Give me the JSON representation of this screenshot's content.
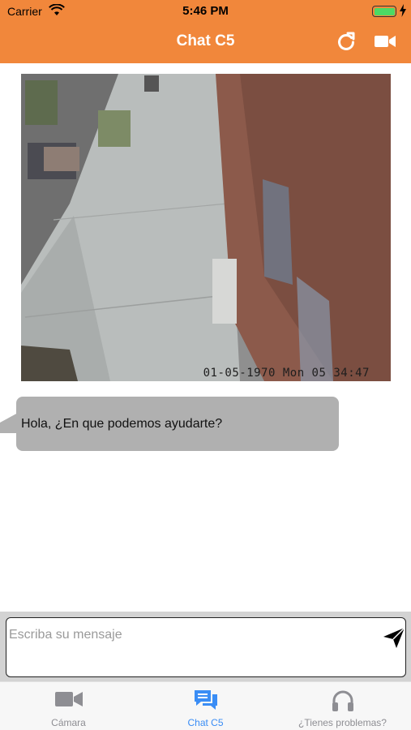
{
  "status_bar": {
    "carrier": "Carrier",
    "time": "5:46 PM",
    "battery_color": "#4CD964"
  },
  "nav": {
    "title": "Chat C5",
    "background": "#F1873B",
    "right_icons": [
      "refresh-icon",
      "video-camera-icon"
    ]
  },
  "camera_feed": {
    "timestamp": "01-05-1970 Mon 05 34:47"
  },
  "messages": [
    {
      "from": "agent",
      "text": "Hola, ¿En que podemos ayudarte?",
      "bubble_color": "#B0B0B0"
    }
  ],
  "composer": {
    "placeholder": "Escriba su mensaje",
    "value": "",
    "send_icon": "send-icon"
  },
  "tabs": [
    {
      "label": "Cámara",
      "icon": "video-camera-icon",
      "active": false
    },
    {
      "label": "Chat C5",
      "icon": "chat-bubbles-icon",
      "active": true
    },
    {
      "label": "¿Tienes problemas?",
      "icon": "headphones-icon",
      "active": false
    }
  ],
  "colors": {
    "accent": "#F1873B",
    "tab_active": "#3A8DF5",
    "tab_inactive": "#8E8E93"
  }
}
